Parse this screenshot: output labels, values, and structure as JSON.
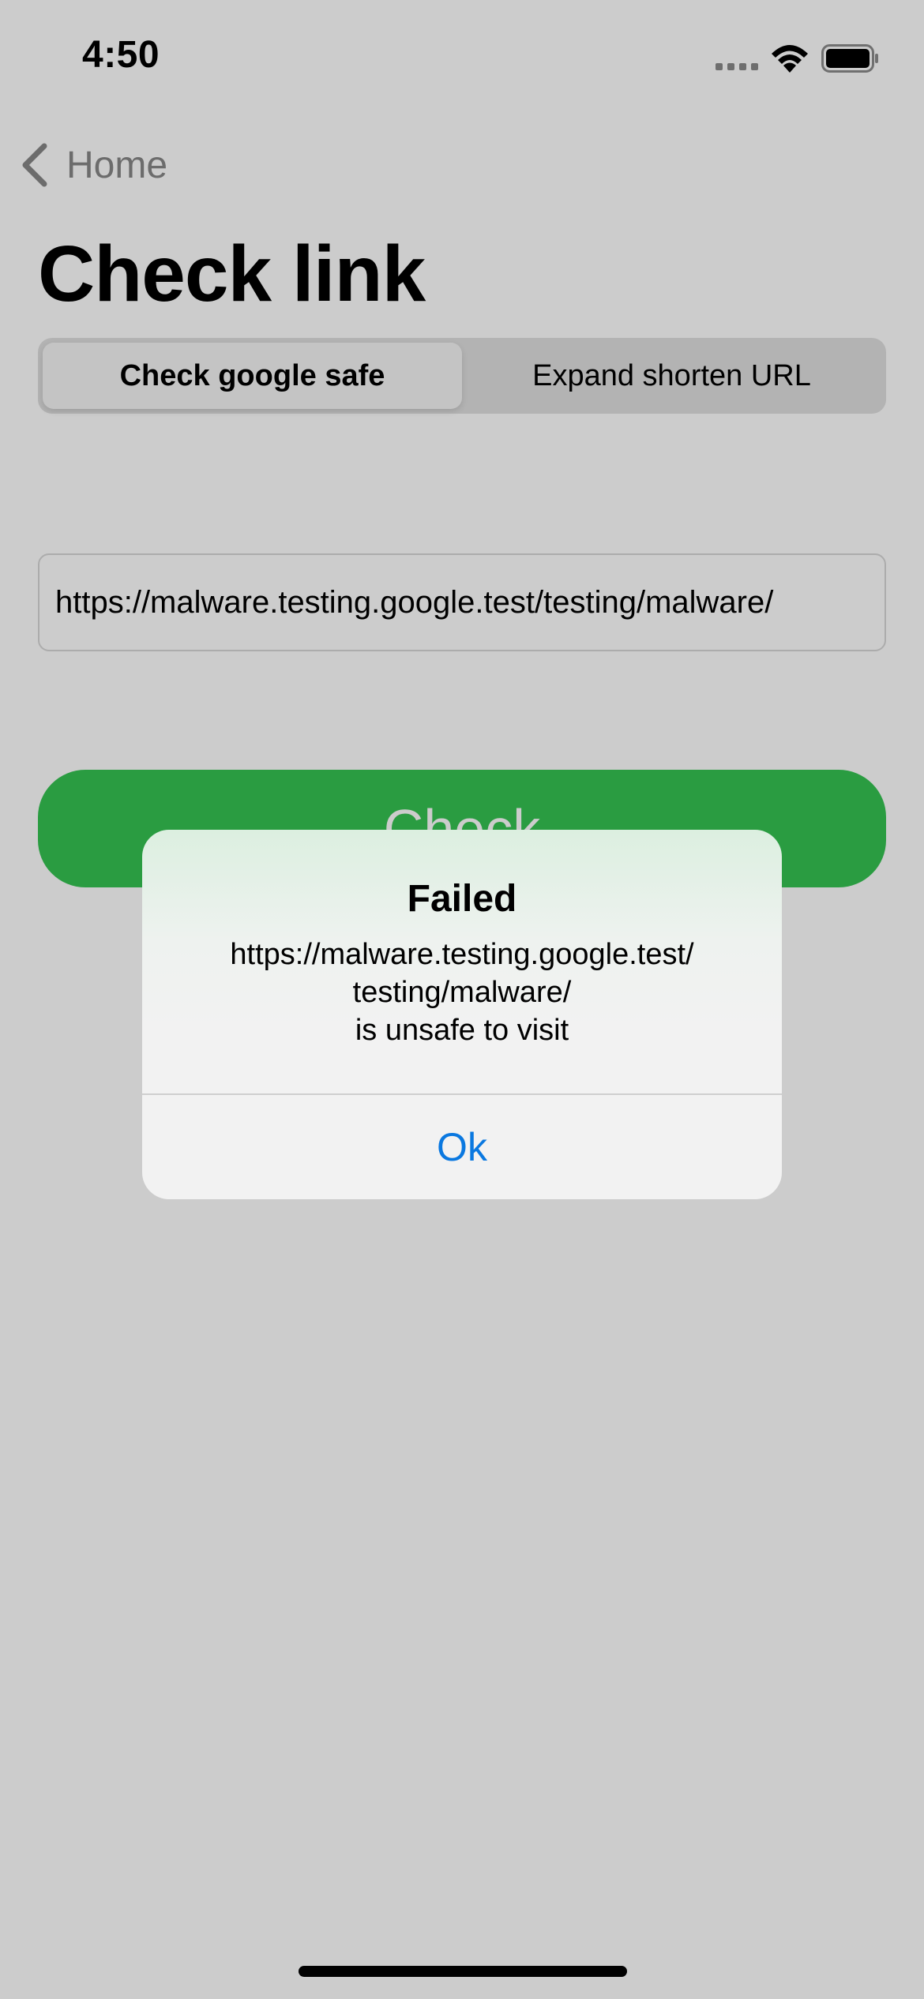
{
  "status_bar": {
    "time": "4:50"
  },
  "nav": {
    "back_label": "Home"
  },
  "page": {
    "title": "Check link"
  },
  "segmented": {
    "items": [
      {
        "label": "Check google safe",
        "selected": true
      },
      {
        "label": "Expand shorten URL",
        "selected": false
      }
    ]
  },
  "url_field": {
    "value": "https://malware.testing.google.test/testing/malware/"
  },
  "check_button": {
    "label": "Check",
    "color": "#35c352"
  },
  "alert": {
    "title": "Failed",
    "message_lines": [
      "https://malware.testing.google.test/",
      "testing/malware/",
      "is unsafe to visit"
    ],
    "ok_label": "Ok",
    "ok_color": "#0a78e0"
  },
  "icons": [
    "chevron-left-icon",
    "cellular-signal-icon",
    "wifi-icon",
    "battery-icon"
  ]
}
